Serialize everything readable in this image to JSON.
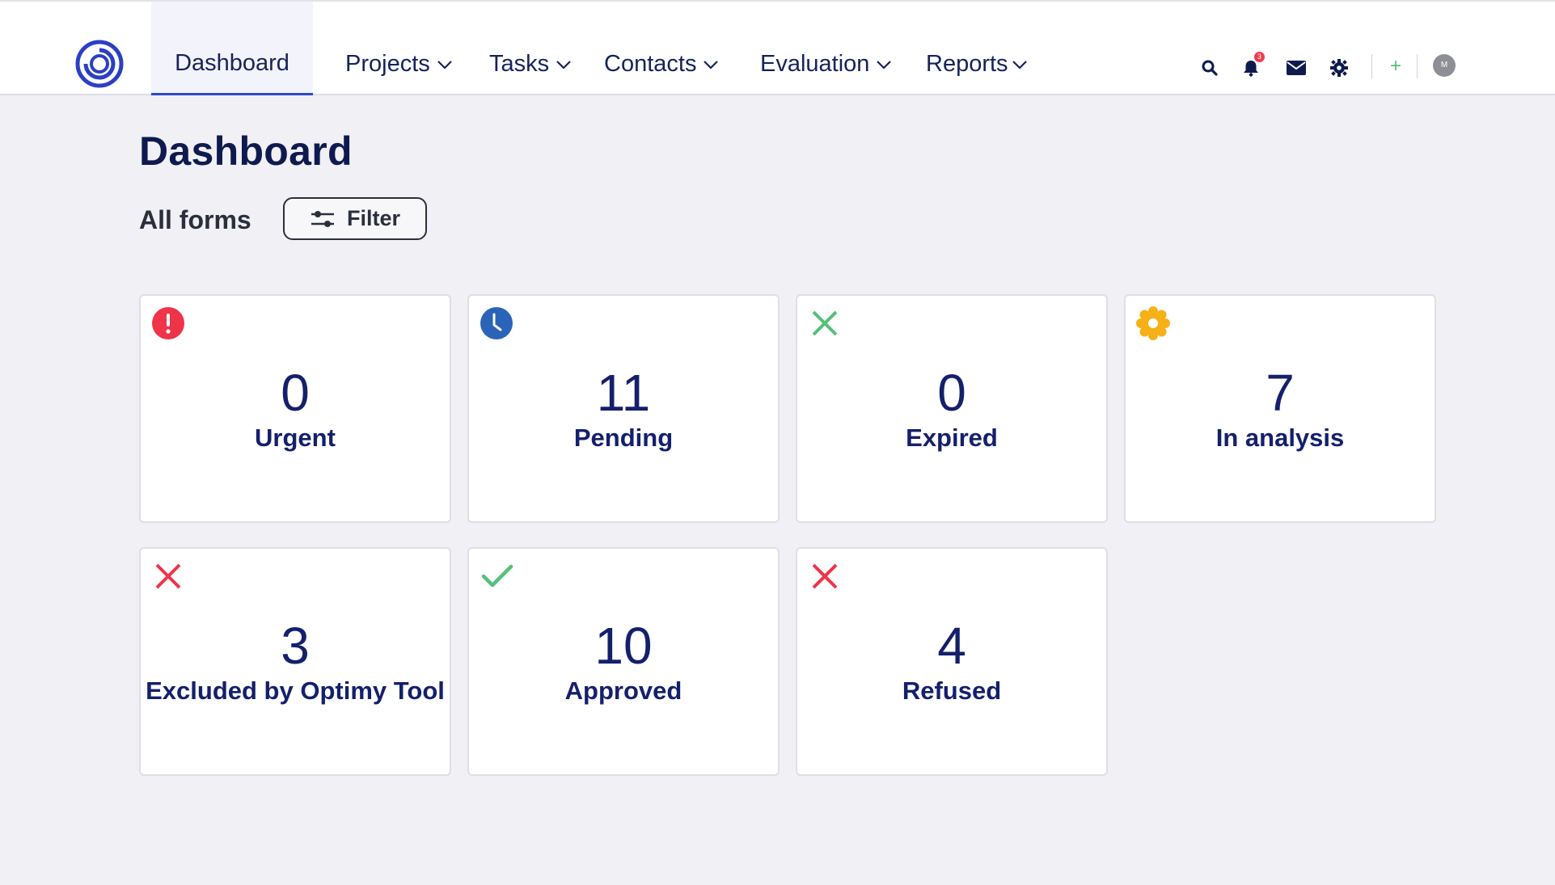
{
  "nav": {
    "items": [
      {
        "label": "Dashboard",
        "active": true
      },
      {
        "label": "Projects"
      },
      {
        "label": "Tasks"
      },
      {
        "label": "Contacts"
      },
      {
        "label": "Evaluation"
      },
      {
        "label": "Reports"
      }
    ]
  },
  "header_icons": {
    "search": "search-icon",
    "notifications": "bell-icon",
    "notifications_count": "3",
    "messages": "mail-icon",
    "settings": "gear-icon",
    "add": "+",
    "avatar_initial": "M"
  },
  "page": {
    "title": "Dashboard",
    "subtitle": "All forms",
    "filter_label": "Filter"
  },
  "cards": [
    {
      "value": "0",
      "label": "Urgent",
      "icon": "exclamation-circle-icon",
      "color": "#ef3348"
    },
    {
      "value": "11",
      "label": "Pending",
      "icon": "clock-icon",
      "color": "#2b63b8"
    },
    {
      "value": "0",
      "label": "Expired",
      "icon": "x-icon",
      "color": "#55c07a"
    },
    {
      "value": "7",
      "label": "In analysis",
      "icon": "gear-icon",
      "color": "#f6b018"
    },
    {
      "value": "3",
      "label": "Excluded by Optimy Tool",
      "icon": "x-icon",
      "color": "#ef3348"
    },
    {
      "value": "10",
      "label": "Approved",
      "icon": "check-icon",
      "color": "#55c07a"
    },
    {
      "value": "4",
      "label": "Refused",
      "icon": "x-icon",
      "color": "#ef3348"
    }
  ],
  "colors": {
    "accent": "#2e49c8",
    "navy": "#14206b",
    "background": "#f0f0f5"
  }
}
